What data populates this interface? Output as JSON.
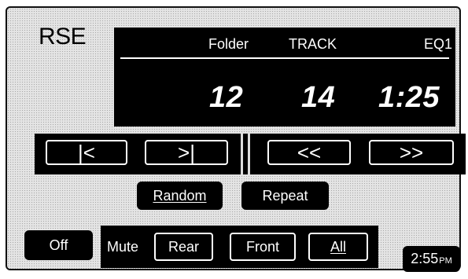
{
  "title": "RSE",
  "info": {
    "folder_label": "Folder",
    "track_label": "TRACK",
    "eq_label": "EQ1",
    "folder_value": "12",
    "track_value": "14",
    "time_value": "1:25"
  },
  "transport": {
    "prev_label": "|<",
    "next_label": ">|",
    "rewind_label": "<<",
    "forward_label": ">>"
  },
  "play_modes": {
    "random_label": "Random",
    "repeat_label": "Repeat"
  },
  "power": {
    "off_label": "Off"
  },
  "mute": {
    "label": "Mute",
    "rear_label": "Rear",
    "front_label": "Front",
    "all_label": "All"
  },
  "clock": {
    "time": "2:55",
    "meridiem": "PM"
  }
}
